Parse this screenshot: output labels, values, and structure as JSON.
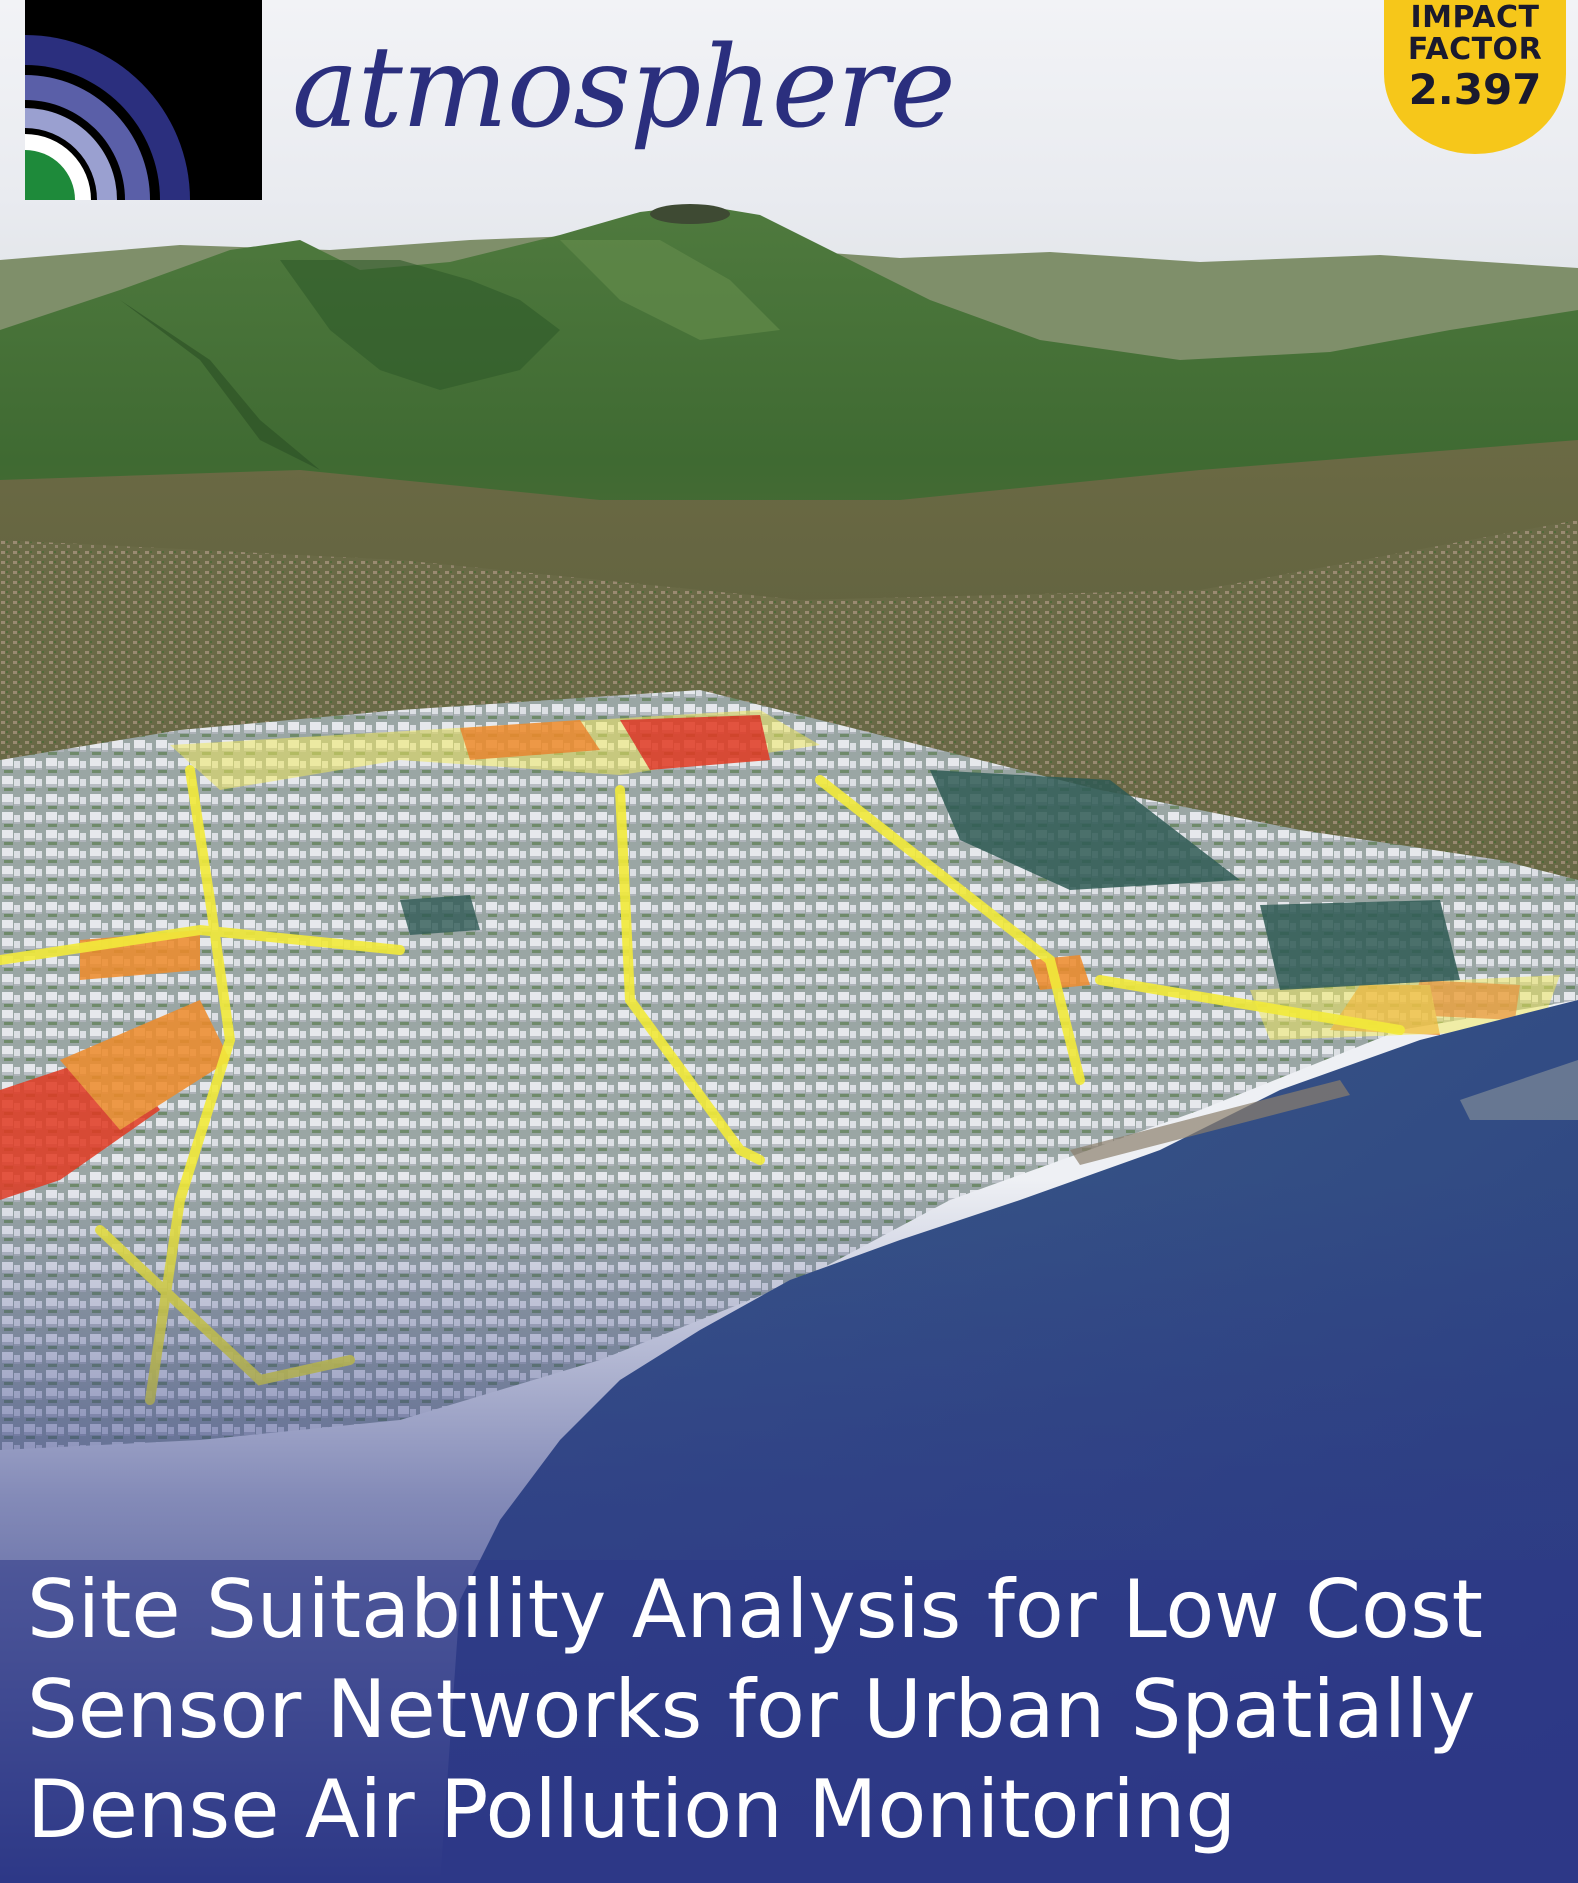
{
  "journal": {
    "name": "atmosphere",
    "impact_factor_label_1": "IMPACT",
    "impact_factor_label_2": "FACTOR",
    "impact_factor_value": "2.397"
  },
  "article": {
    "title_lines": [
      "Site Suitability Analysis for Low Cost",
      "Sensor Networks for Urban Spatially",
      "Dense Air Pollution Monitoring"
    ]
  },
  "colors": {
    "brand_navy": "#2b2f7e",
    "badge_yellow": "#f6c71a",
    "overlay_blue": "#2d3887"
  },
  "icons": {
    "journal_logo": "concentric-arcs-logo-icon"
  }
}
